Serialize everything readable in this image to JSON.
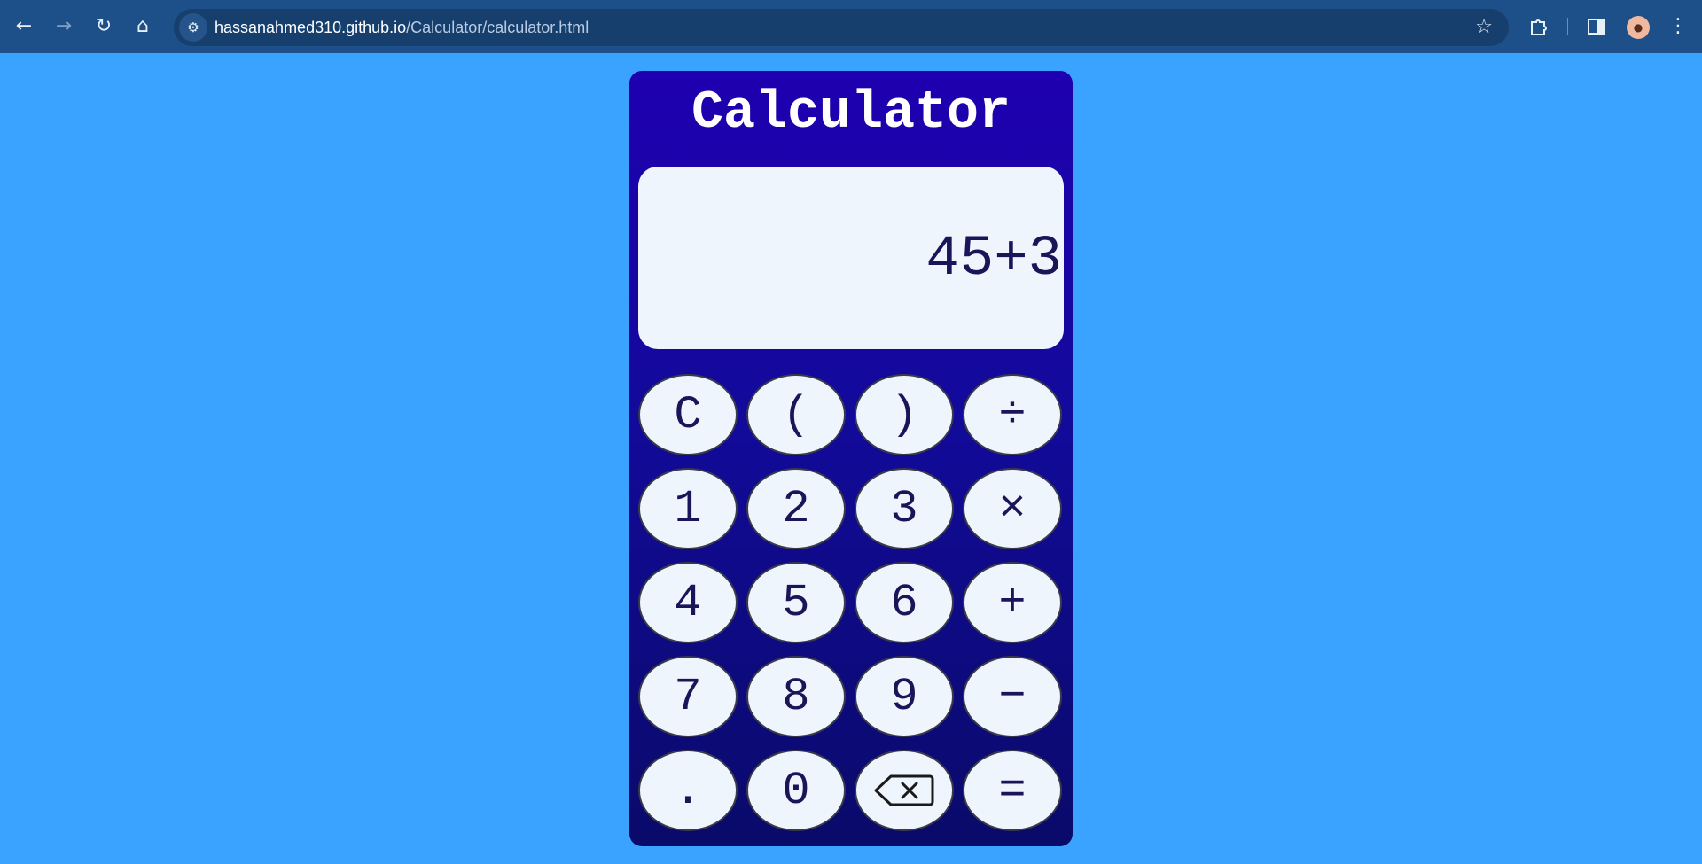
{
  "browser": {
    "url_host": "hassanahmed310.github.io",
    "url_path": "/Calculator/calculator.html",
    "icons": {
      "back": "back-arrow-icon",
      "forward": "forward-arrow-icon",
      "reload": "reload-icon",
      "home": "home-icon",
      "site_info": "tune-icon",
      "bookmark": "star-icon",
      "extensions": "puzzle-icon",
      "side_panel": "side-panel-icon",
      "profile": "avatar-icon",
      "menu": "kebab-menu-icon"
    }
  },
  "calculator": {
    "title": "Calculator",
    "display": "45+3",
    "keys": [
      [
        "C",
        "(",
        ")",
        "÷"
      ],
      [
        "1",
        "2",
        "3",
        "×"
      ],
      [
        "4",
        "5",
        "6",
        "+"
      ],
      [
        "7",
        "8",
        "9",
        "−"
      ],
      [
        ".",
        "0",
        "backspace",
        "="
      ]
    ]
  },
  "colors": {
    "page_background": "#3aa3ff",
    "calculator_top": "#1f00b0",
    "calculator_bottom": "#0a0a6a",
    "key_fill": "#eef5fd",
    "key_text": "#1a1458"
  }
}
